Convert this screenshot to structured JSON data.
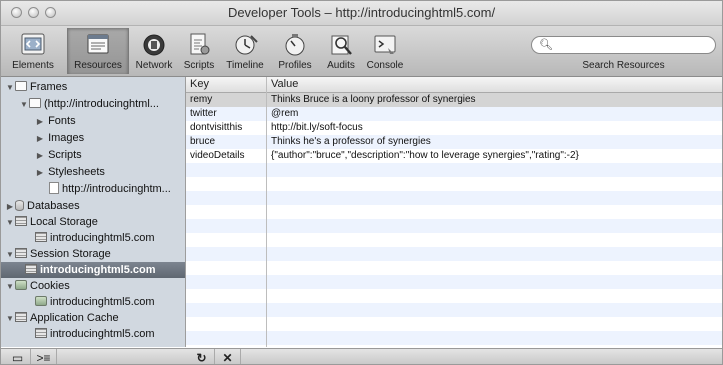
{
  "window": {
    "title": "Developer Tools – http://introducinghtml5.com/"
  },
  "toolbar": {
    "tabs": [
      {
        "label": "Elements",
        "icon": "elements-icon"
      },
      {
        "label": "Resources",
        "icon": "resources-icon",
        "selected": true
      },
      {
        "label": "Network",
        "icon": "network-icon"
      },
      {
        "label": "Scripts",
        "icon": "scripts-icon"
      },
      {
        "label": "Timeline",
        "icon": "timeline-icon"
      },
      {
        "label": "Profiles",
        "icon": "profiles-icon"
      },
      {
        "label": "Audits",
        "icon": "audits-icon"
      },
      {
        "label": "Console",
        "icon": "console-icon"
      }
    ],
    "search": {
      "label": "Search Resources",
      "value": ""
    }
  },
  "sidebar": {
    "items": [
      {
        "label": "Frames",
        "disclosure": "▼",
        "icon": "folder-icon"
      },
      {
        "label": "(http://introducinghtml...",
        "disclosure": "▼",
        "icon": "folder-icon"
      },
      {
        "label": "Fonts",
        "disclosure": "▶"
      },
      {
        "label": "Images",
        "disclosure": "▶"
      },
      {
        "label": "Scripts",
        "disclosure": "▶"
      },
      {
        "label": "Stylesheets",
        "disclosure": "▶"
      },
      {
        "label": "http://introducinghtm...",
        "icon": "document-icon"
      },
      {
        "label": "Databases",
        "disclosure": "▶",
        "icon": "database-icon"
      },
      {
        "label": "Local Storage",
        "disclosure": "▼",
        "icon": "storage-grid-icon"
      },
      {
        "label": "introducinghtml5.com",
        "icon": "storage-grid-icon"
      },
      {
        "label": "Session Storage",
        "disclosure": "▼",
        "icon": "storage-grid-icon"
      },
      {
        "label": "introducinghtml5.com",
        "icon": "storage-grid-icon",
        "selected": true
      },
      {
        "label": "Cookies",
        "disclosure": "▼",
        "icon": "cookie-icon"
      },
      {
        "label": "introducinghtml5.com",
        "icon": "cookie-icon"
      },
      {
        "label": "Application Cache",
        "disclosure": "▼",
        "icon": "storage-grid-icon"
      },
      {
        "label": "introducinghtml5.com",
        "icon": "storage-grid-icon"
      }
    ]
  },
  "table": {
    "columns": [
      "Key",
      "Value"
    ],
    "rows": [
      {
        "key": "remy",
        "value": "Thinks Bruce is a loony professor of synergies",
        "selected": true
      },
      {
        "key": "twitter",
        "value": "@rem"
      },
      {
        "key": "dontvisitthis",
        "value": "http://bit.ly/soft-focus"
      },
      {
        "key": "bruce",
        "value": "Thinks he's a professor of synergies"
      },
      {
        "key": "videoDetails",
        "value": "{\"author\":\"bruce\",\"description\":\"how to leverage synergies\",\"rating\":-2}"
      }
    ],
    "empty_rows": 13
  },
  "bottom_bar": {
    "buttons": [
      {
        "glyph": "▭",
        "icon": "dock-icon"
      },
      {
        "glyph": ">≡",
        "icon": "console-toggle-icon"
      },
      {
        "glyph": "↻",
        "icon": "refresh-icon"
      },
      {
        "glyph": "✕",
        "icon": "delete-icon"
      }
    ]
  }
}
